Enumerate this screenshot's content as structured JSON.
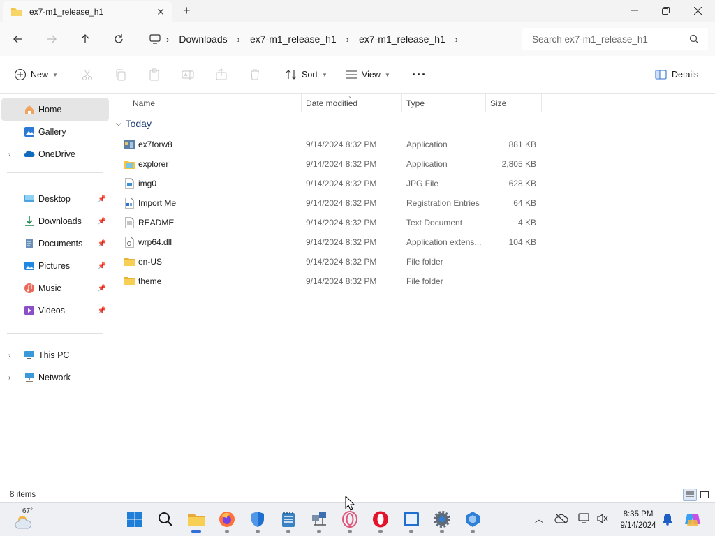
{
  "window": {
    "tab_title": "ex7-m1_release_h1",
    "new_tab_symbol": "+",
    "close_symbol": "✕"
  },
  "address": {
    "crumbs": [
      "Downloads",
      "ex7-m1_release_h1",
      "ex7-m1_release_h1"
    ],
    "search_placeholder": "Search ex7-m1_release_h1"
  },
  "toolbar": {
    "new_label": "New",
    "sort_label": "Sort",
    "view_label": "View",
    "more_label": "···",
    "details_label": "Details"
  },
  "sidebar": {
    "items": [
      {
        "label": "Home",
        "icon": "home-icon"
      },
      {
        "label": "Gallery",
        "icon": "gallery-icon"
      },
      {
        "label": "OneDrive",
        "icon": "onedrive-icon"
      },
      {
        "label": "Desktop",
        "icon": "desktop-icon"
      },
      {
        "label": "Downloads",
        "icon": "download-icon"
      },
      {
        "label": "Documents",
        "icon": "documents-icon"
      },
      {
        "label": "Pictures",
        "icon": "pictures-icon"
      },
      {
        "label": "Music",
        "icon": "music-icon"
      },
      {
        "label": "Videos",
        "icon": "videos-icon"
      },
      {
        "label": "This PC",
        "icon": "computer-icon"
      },
      {
        "label": "Network",
        "icon": "network-icon"
      }
    ]
  },
  "filelist": {
    "columns": [
      "Name",
      "Date modified",
      "Type",
      "Size"
    ],
    "group_label": "Today",
    "rows": [
      {
        "name": "ex7forw8",
        "date": "9/14/2024 8:32 PM",
        "type": "Application",
        "size": "881 KB",
        "icon": "application-icon"
      },
      {
        "name": "explorer",
        "date": "9/14/2024 8:32 PM",
        "type": "Application",
        "size": "2,805 KB",
        "icon": "explorer-app-icon"
      },
      {
        "name": "img0",
        "date": "9/14/2024 8:32 PM",
        "type": "JPG File",
        "size": "628 KB",
        "icon": "image-file-icon"
      },
      {
        "name": "Import Me",
        "date": "9/14/2024 8:32 PM",
        "type": "Registration Entries",
        "size": "64 KB",
        "icon": "registry-file-icon"
      },
      {
        "name": "README",
        "date": "9/14/2024 8:32 PM",
        "type": "Text Document",
        "size": "4 KB",
        "icon": "text-file-icon"
      },
      {
        "name": "wrp64.dll",
        "date": "9/14/2024 8:32 PM",
        "type": "Application extens...",
        "size": "104 KB",
        "icon": "dll-file-icon"
      },
      {
        "name": "en-US",
        "date": "9/14/2024 8:32 PM",
        "type": "File folder",
        "size": "",
        "icon": "folder-icon"
      },
      {
        "name": "theme",
        "date": "9/14/2024 8:32 PM",
        "type": "File folder",
        "size": "",
        "icon": "folder-icon"
      }
    ]
  },
  "status": {
    "item_count": "8 items"
  },
  "taskbar": {
    "weather_temp": "67°",
    "time": "8:35 PM",
    "date": "9/14/2024"
  },
  "colors": {
    "folder": "#f4c542",
    "accent": "#2f6fd6",
    "group_header": "#1f3d73",
    "selected": "#e5e5e5"
  }
}
